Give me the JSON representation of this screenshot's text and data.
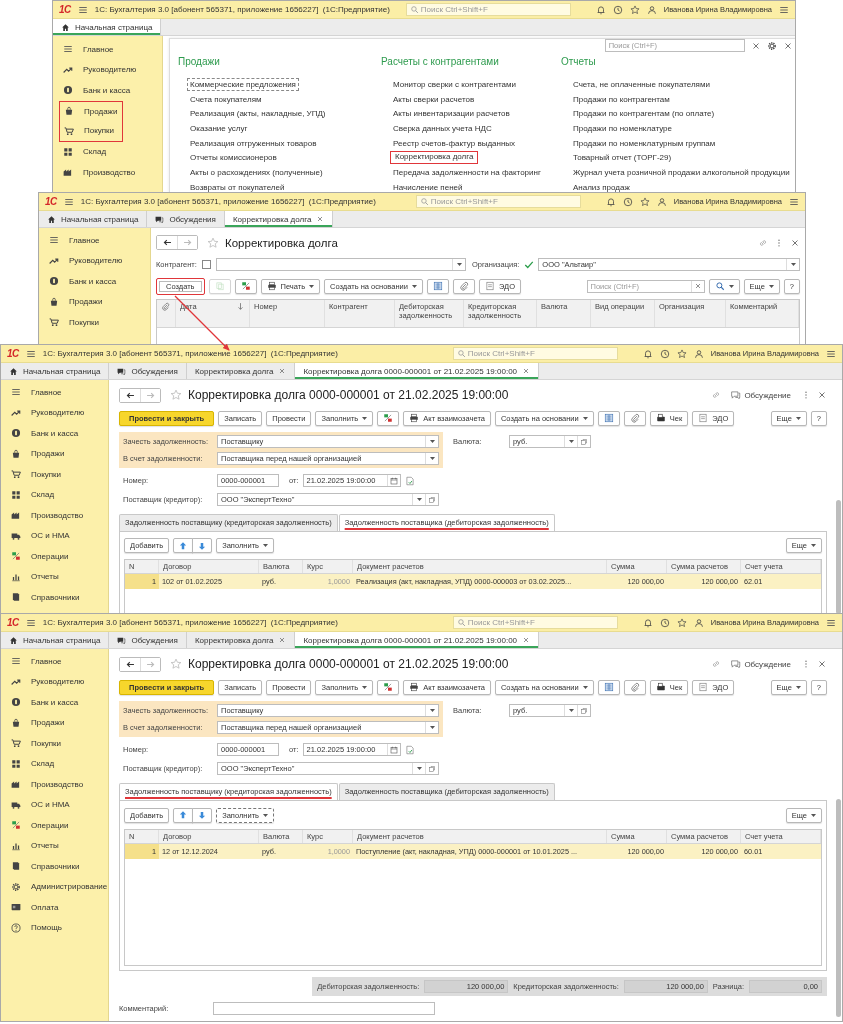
{
  "windows": [
    {
      "kind": "home",
      "logo": "1С",
      "title": "1С: Бухгалтерия 3.0 [абонент 565371, приложение 1656227]  (1С:Предприятие)",
      "search_placeholder": "Поиск Ctrl+Shift+F",
      "user": "Иванова Ирина Владимировна",
      "tabs": [
        {
          "label": "Начальная страница",
          "selected": true,
          "closable": false
        }
      ],
      "sidebar": [
        {
          "label": "Главное",
          "highlighted": false
        },
        {
          "label": "Руководителю",
          "highlighted": false
        },
        {
          "label": "Банк и касса",
          "highlighted": false
        },
        {
          "label": "Продажи",
          "highlighted": true
        },
        {
          "label": "Покупки",
          "highlighted": true
        },
        {
          "label": "Склад",
          "highlighted": false
        },
        {
          "label": "Производство",
          "highlighted": false
        }
      ],
      "panel": {
        "search_placeholder": "Поиск (Ctrl+F)",
        "sections": [
          {
            "title": "Продажи",
            "items": [
              {
                "label": "Коммерческие предложения",
                "highlighted": false,
                "focused": true
              },
              {
                "label": "Счета покупателям",
                "highlighted": false,
                "focused": false
              },
              {
                "label": "Реализация (акты, накладные, УПД)",
                "highlighted": false,
                "focused": false
              },
              {
                "label": "Оказание услуг",
                "highlighted": false,
                "focused": false
              },
              {
                "label": "Реализация отгруженных товаров",
                "highlighted": false,
                "focused": false
              },
              {
                "label": "Отчеты комиссионеров",
                "highlighted": false,
                "focused": false
              },
              {
                "label": "Акты о расхождениях (полученные)",
                "highlighted": false,
                "focused": false
              },
              {
                "label": "Возвраты от покупателей",
                "highlighted": false,
                "focused": false
              }
            ]
          },
          {
            "title": "Расчеты с контрагентами",
            "items": [
              {
                "label": "Монитор сверки с контрагентами",
                "highlighted": false,
                "focused": false
              },
              {
                "label": "Акты сверки расчетов",
                "highlighted": false,
                "focused": false
              },
              {
                "label": "Акты инвентаризации расчетов",
                "highlighted": false,
                "focused": false
              },
              {
                "label": "Сверка данных учета НДС",
                "highlighted": false,
                "focused": false
              },
              {
                "label": "Реестр счетов-фактур выданных",
                "highlighted": false,
                "focused": false
              },
              {
                "label": "Корректировка долга",
                "highlighted": true,
                "focused": false
              },
              {
                "label": "Передача задолженности на факторинг",
                "highlighted": false,
                "focused": false
              },
              {
                "label": "Начисление пеней",
                "highlighted": false,
                "focused": false
              }
            ]
          },
          {
            "title": "Отчеты",
            "items": [
              {
                "label": "Счета, не оплаченные покупателями",
                "highlighted": false,
                "focused": false
              },
              {
                "label": "Продажи по контрагентам",
                "highlighted": false,
                "focused": false
              },
              {
                "label": "Продажи по контрагентам (по оплате)",
                "highlighted": false,
                "focused": false
              },
              {
                "label": "Продажи по номенклатуре",
                "highlighted": false,
                "focused": false
              },
              {
                "label": "Продажи по номенклатурным группам",
                "highlighted": false,
                "focused": false
              },
              {
                "label": "Товарный отчет (ТОРГ-29)",
                "highlighted": false,
                "focused": false
              },
              {
                "label": "Журнал учета розничной продажи алкогольной продукции",
                "highlighted": false,
                "focused": false
              },
              {
                "label": "Анализ продаж",
                "highlighted": false,
                "focused": false
              }
            ]
          }
        ]
      }
    },
    {
      "kind": "list",
      "logo": "1С",
      "title": "1С: Бухгалтерия 3.0 [абонент 565371, приложение 1656227]  (1С:Предприятие)",
      "search_placeholder": "Поиск Ctrl+Shift+F",
      "user": "Иванова Ирина Владимировна",
      "tabs": [
        {
          "label": "Начальная страница",
          "selected": false,
          "closable": false
        },
        {
          "label": "Обсуждения",
          "selected": false,
          "closable": false
        },
        {
          "label": "Корректировка долга",
          "selected": true,
          "closable": true
        }
      ],
      "sidebar": [
        {
          "label": "Главное",
          "highlighted": false
        },
        {
          "label": "Руководителю",
          "highlighted": false
        },
        {
          "label": "Банк и касса",
          "highlighted": false
        },
        {
          "label": "Продажи",
          "highlighted": false
        },
        {
          "label": "Покупки",
          "highlighted": false
        }
      ],
      "form": {
        "heading": "Корректировка долга",
        "filters": [
          {
            "label": "Контрагент:",
            "checked": false
          },
          {
            "label": "Организация:",
            "checked": true,
            "value": "ООО \"Альтаир\""
          }
        ],
        "toolbar": {
          "left": [
            {
              "kind": "button",
              "label": "Создать",
              "highlighted": true,
              "disabled": false
            },
            {
              "kind": "copy",
              "highlighted": false,
              "disabled": true
            },
            {
              "kind": "dtkt",
              "highlighted": false,
              "disabled": false
            },
            {
              "kind": "print_menu",
              "label": "Печать",
              "highlighted": false,
              "disabled": false
            },
            {
              "kind": "menu",
              "label": "Создать на основании",
              "highlighted": false,
              "disabled": false
            },
            {
              "kind": "report",
              "highlighted": false,
              "disabled": false
            },
            {
              "kind": "clip",
              "highlighted": false,
              "disabled": false
            },
            {
              "kind": "edo",
              "label": "ЭДО",
              "highlighted": false,
              "disabled": false
            }
          ],
          "right": [
            {
              "kind": "search_field",
              "placeholder": "Поиск (Ctrl+F)"
            },
            {
              "kind": "search"
            },
            {
              "kind": "menu",
              "label": "Еще"
            },
            {
              "kind": "button",
              "label": "?"
            }
          ]
        },
        "table": {
          "columns": [
            {
              "kind": "attachment"
            },
            {
              "kind": "text",
              "label": "Дата",
              "sorted": true
            },
            {
              "kind": "text",
              "label": "Номер",
              "sorted": false
            },
            {
              "kind": "text",
              "label": "Контрагент",
              "sorted": false
            },
            {
              "kind": "text",
              "label": "Дебиторская задолженность",
              "sorted": false
            },
            {
              "kind": "text",
              "label": "Кредиторская задолженность",
              "sorted": false
            },
            {
              "kind": "text",
              "label": "Валюта",
              "sorted": false
            },
            {
              "kind": "text",
              "label": "Вид операции",
              "sorted": false
            },
            {
              "kind": "text",
              "label": "Организация",
              "sorted": false
            },
            {
              "kind": "text",
              "label": "Комментарий",
              "sorted": false
            }
          ]
        }
      }
    },
    {
      "kind": "document",
      "logo": "1С",
      "title": "1С: Бухгалтерия 3.0 [абонент 565371, приложение 1656227]  (1С:Предприятие)",
      "search_placeholder": "Поиск Ctrl+Shift+F",
      "user": "Иванова Ирина Владимировна",
      "tabs": [
        {
          "label": "Начальная страница",
          "selected": false,
          "closable": false
        },
        {
          "label": "Обсуждения",
          "selected": false,
          "closable": false
        },
        {
          "label": "Корректировка долга",
          "selected": false,
          "closable": true
        },
        {
          "label": "Корректировка долга 0000-000001 от 21.02.2025 19:00:00",
          "selected": true,
          "closable": true
        }
      ],
      "sidebar": [
        {
          "label": "Главное",
          "highlighted": false
        },
        {
          "label": "Руководителю",
          "highlighted": false
        },
        {
          "label": "Банк и касса",
          "highlighted": false
        },
        {
          "label": "Продажи",
          "highlighted": false
        },
        {
          "label": "Покупки",
          "highlighted": false
        },
        {
          "label": "Склад",
          "highlighted": false
        },
        {
          "label": "Производство",
          "highlighted": false
        },
        {
          "label": "ОС и НМА",
          "highlighted": false
        },
        {
          "label": "Операции",
          "highlighted": false
        },
        {
          "label": "Отчеты",
          "highlighted": false
        },
        {
          "label": "Справочники",
          "highlighted": false
        }
      ],
      "form": {
        "heading": "Корректировка долга 0000-000001 от 21.02.2025 19:00:00",
        "discussion": "Обсуждение",
        "toolbar": {
          "left": [
            {
              "kind": "primary",
              "label": "Провести и закрыть"
            },
            {
              "kind": "button",
              "label": "Записать"
            },
            {
              "kind": "button",
              "label": "Провести"
            },
            {
              "kind": "menu",
              "label": "Заполнить"
            },
            {
              "kind": "dtkt"
            },
            {
              "kind": "print",
              "label": "Акт взаимозачета"
            },
            {
              "kind": "menu",
              "label": "Создать на основании"
            },
            {
              "kind": "report"
            },
            {
              "kind": "clip"
            },
            {
              "kind": "receipt",
              "label": "Чек"
            },
            {
              "kind": "edo",
              "label": "ЭДО"
            }
          ],
          "right": [
            {
              "kind": "menu",
              "label": "Еще"
            },
            {
              "kind": "button",
              "label": "?"
            }
          ]
        },
        "offset": [
          {
            "label": "Зачесть задолженность:",
            "value": "Поставщику"
          },
          {
            "label": "В счет задолженности:",
            "value": "Поставщика перед нашей организацией"
          }
        ],
        "currency": {
          "label": "Валюта:",
          "value": "руб."
        },
        "number": {
          "label": "Номер:",
          "value": "0000-000001"
        },
        "date": {
          "label": "от:",
          "value": "21.02.2025 19:00:00"
        },
        "supplier": {
          "label": "Поставщик (кредитор):",
          "value": "ООО \"ЭкспертТехно\""
        },
        "tabs": [
          {
            "label": "Задолженность поставщику (кредиторская задолженность)",
            "selected": false,
            "highlighted": false
          },
          {
            "label": "Задолженность поставщика (дебиторская задолженность)",
            "selected": true,
            "highlighted": true
          }
        ],
        "table_toolbar": {
          "left": [
            {
              "kind": "button",
              "label": "Добавить",
              "focused": false
            },
            {
              "kind": "up",
              "focused": false
            },
            {
              "kind": "down",
              "focused": false
            },
            {
              "kind": "menu",
              "label": "Заполнить",
              "focused": false
            }
          ],
          "right": [
            {
              "kind": "menu",
              "label": "Еще"
            }
          ]
        },
        "table": {
          "columns": [
            {
              "label": "N"
            },
            {
              "label": "Договор"
            },
            {
              "label": "Валюта"
            },
            {
              "label": "Курс"
            },
            {
              "label": "Документ расчетов"
            },
            {
              "label": "Сумма"
            },
            {
              "label": "Сумма расчетов"
            },
            {
              "label": "Счет учета"
            }
          ],
          "rows": [
            {
              "selected": true,
              "cells": [
                "1",
                "102 от 01.02.2025",
                "руб.",
                "1,0000",
                "Реализация (акт, накладная, УПД) 0000-000003 от 03.02.2025...",
                "120 000,00",
                "120 000,00",
                "62.01"
              ]
            }
          ]
        }
      }
    },
    {
      "kind": "document",
      "logo": "1С",
      "title": "1С: Бухгалтерия 3.0 [абонент 565371, приложение 1656227]  (1С:Предприятие)",
      "search_placeholder": "Поиск Ctrl+Shift+F",
      "user": "Иванова Ирина Владимировна",
      "tabs": [
        {
          "label": "Начальная страница",
          "selected": false,
          "closable": false
        },
        {
          "label": "Обсуждения",
          "selected": false,
          "closable": false
        },
        {
          "label": "Корректировка долга",
          "selected": false,
          "closable": true
        },
        {
          "label": "Корректировка долга 0000-000001 от 21.02.2025 19:00:00",
          "selected": true,
          "closable": true
        }
      ],
      "sidebar": [
        {
          "label": "Главное",
          "highlighted": false
        },
        {
          "label": "Руководителю",
          "highlighted": false
        },
        {
          "label": "Банк и касса",
          "highlighted": false
        },
        {
          "label": "Продажи",
          "highlighted": false
        },
        {
          "label": "Покупки",
          "highlighted": false
        },
        {
          "label": "Склад",
          "highlighted": false
        },
        {
          "label": "Производство",
          "highlighted": false
        },
        {
          "label": "ОС и НМА",
          "highlighted": false
        },
        {
          "label": "Операции",
          "highlighted": false
        },
        {
          "label": "Отчеты",
          "highlighted": false
        },
        {
          "label": "Справочники",
          "highlighted": false
        },
        {
          "label": "Администрирование",
          "highlighted": false
        },
        {
          "label": "Оплата",
          "highlighted": false
        },
        {
          "label": "Помощь",
          "highlighted": false
        }
      ],
      "form": {
        "heading": "Корректировка долга 0000-000001 от 21.02.2025 19:00:00",
        "discussion": "Обсуждение",
        "toolbar": {
          "left": [
            {
              "kind": "primary",
              "label": "Провести и закрыть"
            },
            {
              "kind": "button",
              "label": "Записать"
            },
            {
              "kind": "button",
              "label": "Провести"
            },
            {
              "kind": "menu",
              "label": "Заполнить"
            },
            {
              "kind": "dtkt"
            },
            {
              "kind": "print",
              "label": "Акт взаимозачета"
            },
            {
              "kind": "menu",
              "label": "Создать на основании"
            },
            {
              "kind": "report"
            },
            {
              "kind": "clip"
            },
            {
              "kind": "receipt",
              "label": "Чек"
            },
            {
              "kind": "edo",
              "label": "ЭДО"
            }
          ],
          "right": [
            {
              "kind": "menu",
              "label": "Еще"
            },
            {
              "kind": "button",
              "label": "?"
            }
          ]
        },
        "offset": [
          {
            "label": "Зачесть задолженность:",
            "value": "Поставщику"
          },
          {
            "label": "В счет задолженности:",
            "value": "Поставщика перед нашей организацией"
          }
        ],
        "currency": {
          "label": "Валюта:",
          "value": "руб."
        },
        "number": {
          "label": "Номер:",
          "value": "0000-000001"
        },
        "date": {
          "label": "от:",
          "value": "21.02.2025 19:00:00"
        },
        "supplier": {
          "label": "Поставщик (кредитор):",
          "value": "ООО \"ЭкспертТехно\""
        },
        "tabs": [
          {
            "label": "Задолженность поставщику (кредиторская задолженность)",
            "selected": true,
            "highlighted": true
          },
          {
            "label": "Задолженность поставщика (дебиторская задолженность)",
            "selected": false,
            "highlighted": false
          }
        ],
        "table_toolbar": {
          "left": [
            {
              "kind": "button",
              "label": "Добавить",
              "focused": false
            },
            {
              "kind": "up",
              "focused": false
            },
            {
              "kind": "down",
              "focused": false
            },
            {
              "kind": "menu",
              "label": "Заполнить",
              "focused": true
            }
          ],
          "right": [
            {
              "kind": "menu",
              "label": "Еще"
            }
          ]
        },
        "table": {
          "columns": [
            {
              "label": "N"
            },
            {
              "label": "Договор"
            },
            {
              "label": "Валюта"
            },
            {
              "label": "Курс"
            },
            {
              "label": "Документ расчетов"
            },
            {
              "label": "Сумма"
            },
            {
              "label": "Сумма расчетов"
            },
            {
              "label": "Счет учета"
            }
          ],
          "rows": [
            {
              "selected": true,
              "cells": [
                "1",
                "12 от 12.12.2024",
                "руб.",
                "1,0000",
                "Поступление (акт, накладная, УПД) 0000-000001 от 10.01.2025 ...",
                "120 000,00",
                "120 000,00",
                "60.01"
              ]
            }
          ]
        },
        "totals": [
          {
            "label": "Дебиторская задолженность:",
            "value": "120 000,00"
          },
          {
            "label": "Кредиторская задолженность:",
            "value": "120 000,00"
          },
          {
            "label": "Разница:",
            "value": "0,00"
          }
        ],
        "comment": {
          "label": "Комментарий:"
        }
      }
    }
  ]
}
